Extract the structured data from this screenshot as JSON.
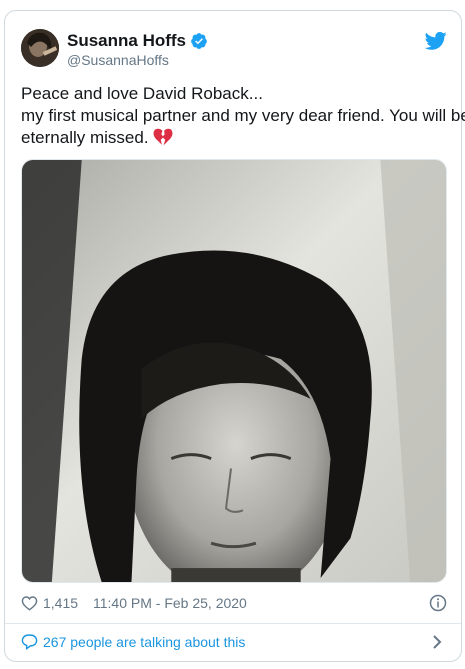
{
  "author": {
    "name": "Susanna Hoffs",
    "handle": "@SusannaHoffs",
    "verified": true
  },
  "tweet": {
    "lines": [
      "Peace and love David Roback...",
      "my first musical partner and my very dear friend. You will be",
      "eternally missed."
    ],
    "emoji": "broken-heart"
  },
  "meta": {
    "likes": "1,415",
    "timestamp": "11:40 PM - Feb 25, 2020"
  },
  "footer": {
    "talking": "267 people are talking about this"
  },
  "colors": {
    "accent": "#1da1f2",
    "link": "#1b95e0",
    "muted": "#657786",
    "text": "#14171a",
    "border": "#cfd9de",
    "heart_emoji": "#dd2e44"
  },
  "icons": [
    "verified-badge-icon",
    "twitter-bird-icon",
    "broken-heart-icon",
    "like-heart-icon",
    "info-icon",
    "reply-icon",
    "chevron-right-icon"
  ]
}
